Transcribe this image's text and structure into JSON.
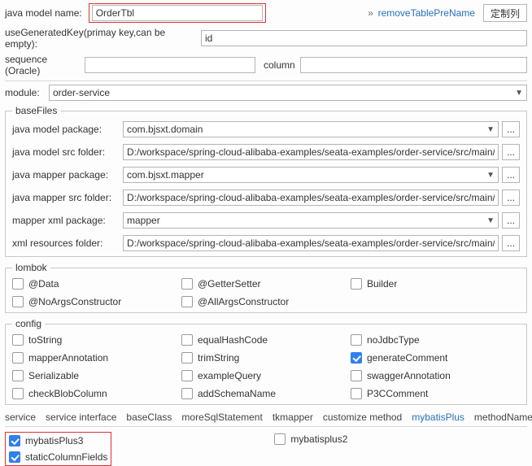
{
  "top": {
    "model_name_label": "java model name:",
    "model_name_value": "OrderTbl",
    "remove_prefix_link": "removeTablePreName",
    "custom_col_btn": "定制列",
    "use_generated_key_label": "useGeneratedKey(primay key,can be empty):",
    "use_generated_key_value": "id",
    "sequence_label": "sequence (Oracle)",
    "sequence_value": "",
    "column_label": "column",
    "column_value": "",
    "module_label": "module:",
    "module_value": "order-service"
  },
  "baseFiles": {
    "legend": "baseFiles",
    "rows": {
      "model_package": {
        "label": "java model package:",
        "value": "com.bjsxt.domain",
        "dropdown": true,
        "dots": true
      },
      "model_src": {
        "label": "java model src folder:",
        "value": "D:/workspace/spring-cloud-alibaba-examples/seata-examples/order-service/src/main/java",
        "dropdown": false,
        "dots": true
      },
      "mapper_package": {
        "label": "java mapper package:",
        "value": "com.bjsxt.mapper",
        "dropdown": true,
        "dots": true
      },
      "mapper_src": {
        "label": "java mapper src folder:",
        "value": "D:/workspace/spring-cloud-alibaba-examples/seata-examples/order-service/src/main/java",
        "dropdown": false,
        "dots": true
      },
      "mapper_xml": {
        "label": "mapper xml package:",
        "value": "mapper",
        "dropdown": true,
        "dots": true
      },
      "xml_resources": {
        "label": "xml resources folder:",
        "value": "D:/workspace/spring-cloud-alibaba-examples/seata-examples/order-service/src/main/resources",
        "dropdown": false,
        "dots": true
      }
    }
  },
  "lombok": {
    "legend": "lombok",
    "options": {
      "data": {
        "label": "@Data",
        "checked": false
      },
      "gettersetter": {
        "label": "@GetterSetter",
        "checked": false
      },
      "builder": {
        "label": "Builder",
        "checked": false
      },
      "noargs": {
        "label": "@NoArgsConstructor",
        "checked": false
      },
      "allargs": {
        "label": "@AllArgsConstructor",
        "checked": false
      }
    }
  },
  "config": {
    "legend": "config",
    "options": {
      "toString": {
        "label": "toString",
        "checked": false
      },
      "equalHashCode": {
        "label": "equalHashCode",
        "checked": false
      },
      "noJdbcType": {
        "label": "noJdbcType",
        "checked": false
      },
      "mapperAnnotation": {
        "label": "mapperAnnotation",
        "checked": false
      },
      "trimString": {
        "label": "trimString",
        "checked": false
      },
      "generateComment": {
        "label": "generateComment",
        "checked": true
      },
      "serializable": {
        "label": "Serializable",
        "checked": false
      },
      "exampleQuery": {
        "label": "exampleQuery",
        "checked": false
      },
      "swaggerAnnotation": {
        "label": "swaggerAnnotation",
        "checked": false
      },
      "checkBlobColumn": {
        "label": "checkBlobColumn",
        "checked": false
      },
      "addSchemaName": {
        "label": "addSchemaName",
        "checked": false
      },
      "p3cComment": {
        "label": "P3CComment",
        "checked": false
      }
    }
  },
  "tabs": {
    "items": [
      "service",
      "service interface",
      "baseClass",
      "moreSqlStatement",
      "tkmapper",
      "customize method",
      "mybatisPlus",
      "methodNameSql"
    ],
    "active_index": 6
  },
  "mybatisPlus": {
    "mybatisPlus3": {
      "label": "mybatisPlus3",
      "checked": true
    },
    "staticColumnFields": {
      "label": "staticColumnFields",
      "checked": true
    },
    "mybatisplus2": {
      "label": "mybatisplus2",
      "checked": false
    }
  }
}
